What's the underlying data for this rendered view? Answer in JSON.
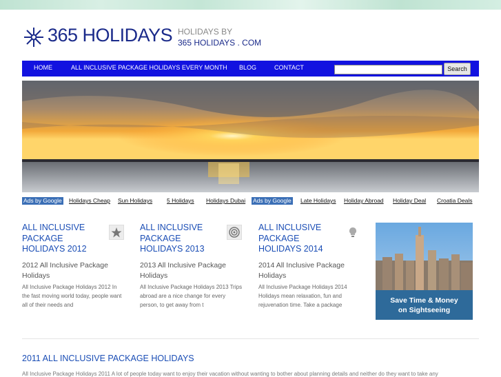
{
  "header": {
    "logo_text": "365 HOLIDAYS",
    "tagline_1": "HOLIDAYS BY",
    "tagline_2": "365 HOLIDAYS . COM"
  },
  "nav": {
    "items": [
      "HOME",
      "ALL INCLUSIVE PACKAGE HOLIDAYS EVERY MONTH",
      "BLOG",
      "CONTACT"
    ],
    "search_value": "",
    "search_button": "Search"
  },
  "ad_links": {
    "label": "Ads by Google",
    "group1": [
      "Holidays Cheap",
      "Sun Holidays",
      "5 Holidays",
      "Holidays Dubai"
    ],
    "group2": [
      "Late Holidays",
      "Holiday Abroad",
      "Holiday Deal",
      "Croatia Deals"
    ]
  },
  "posts": [
    {
      "title": "ALL INCLUSIVE PACKAGE HOLIDAYS 2012",
      "subtitle": "2012 All Inclusive Package Holidays",
      "excerpt": "All Inclusive Package Holidays 2012 In the fast moving world today, people want all of their needs and",
      "icon": "star-icon"
    },
    {
      "title": "ALL INCLUSIVE PACKAGE HOLIDAYS 2013",
      "subtitle": "2013 All Inclusive Package Holidays",
      "excerpt": "All Inclusive Package Holidays 2013 Trips abroad are a nice change for every person, to get away from t",
      "icon": "target-icon"
    },
    {
      "title": "ALL INCLUSIVE PACKAGE HOLIDAYS 2014",
      "subtitle": "2014 All Inclusive Package Holidays",
      "excerpt": "All Inclusive Package Holidays 2014 Holidays mean relaxation, fun and rejuvenation time. Take a package",
      "icon": "lightbulb-icon"
    }
  ],
  "ad_banner": {
    "line1": "Save Time & Money",
    "line2": "on Sightseeing"
  },
  "section": {
    "title": "2011 ALL INCLUSIVE PACKAGE HOLIDAYS",
    "excerpt": "All Inclusive Package Holidays 2011 A lot of people today want to enjoy their vacation without wanting to bother about planning details and neither do they want to take any"
  },
  "colors": {
    "nav": "#1212e0",
    "brand": "#1a2a8a",
    "link": "#1a4db5"
  }
}
